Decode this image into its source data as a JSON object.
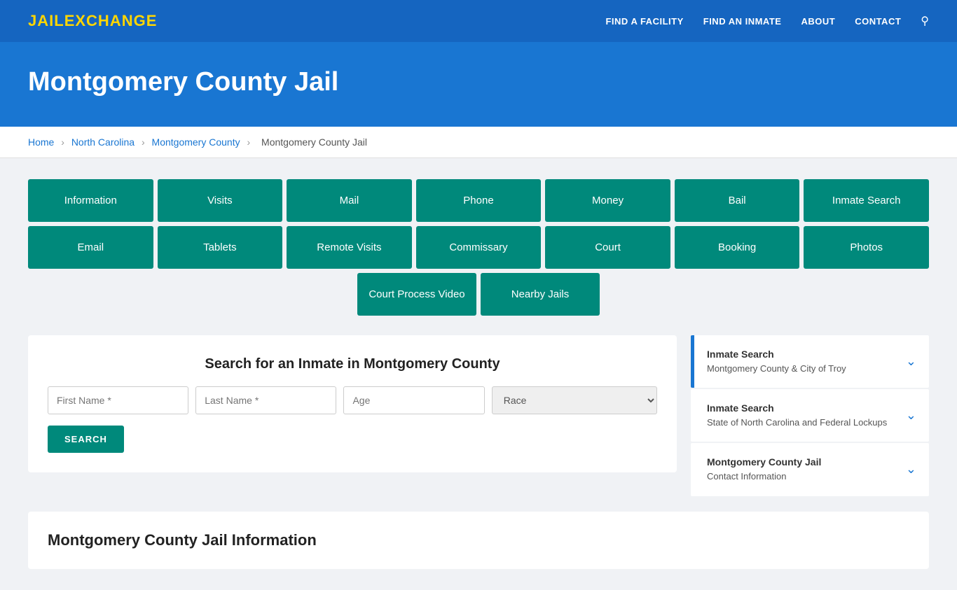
{
  "nav": {
    "logo_jail": "JAIL",
    "logo_exchange": "EXCHANGE",
    "links": [
      {
        "label": "FIND A FACILITY",
        "id": "find-facility"
      },
      {
        "label": "FIND AN INMATE",
        "id": "find-inmate"
      },
      {
        "label": "ABOUT",
        "id": "about"
      },
      {
        "label": "CONTACT",
        "id": "contact"
      }
    ]
  },
  "hero": {
    "title": "Montgomery County Jail"
  },
  "breadcrumb": {
    "items": [
      {
        "label": "Home",
        "id": "home"
      },
      {
        "label": "North Carolina",
        "id": "nc"
      },
      {
        "label": "Montgomery County",
        "id": "mc"
      },
      {
        "label": "Montgomery County Jail",
        "id": "mcj"
      }
    ]
  },
  "buttons_row1": [
    "Information",
    "Visits",
    "Mail",
    "Phone",
    "Money",
    "Bail",
    "Inmate Search"
  ],
  "buttons_row2": [
    "Email",
    "Tablets",
    "Remote Visits",
    "Commissary",
    "Court",
    "Booking",
    "Photos"
  ],
  "buttons_row3": [
    "Court Process Video",
    "Nearby Jails"
  ],
  "search": {
    "title": "Search for an Inmate in Montgomery County",
    "first_name_placeholder": "First Name *",
    "last_name_placeholder": "Last Name *",
    "age_placeholder": "Age",
    "race_placeholder": "Race",
    "button_label": "SEARCH"
  },
  "accordion": {
    "items": [
      {
        "id": "item1",
        "active": true,
        "title_strong": "Inmate Search",
        "title_sub": "Montgomery County & City of Troy"
      },
      {
        "id": "item2",
        "active": false,
        "title_strong": "Inmate Search",
        "title_sub": "State of North Carolina and Federal Lockups"
      },
      {
        "id": "item3",
        "active": false,
        "title_strong": "Montgomery County Jail",
        "title_sub": "Contact Information"
      }
    ]
  },
  "bottom": {
    "title": "Montgomery County Jail Information"
  }
}
